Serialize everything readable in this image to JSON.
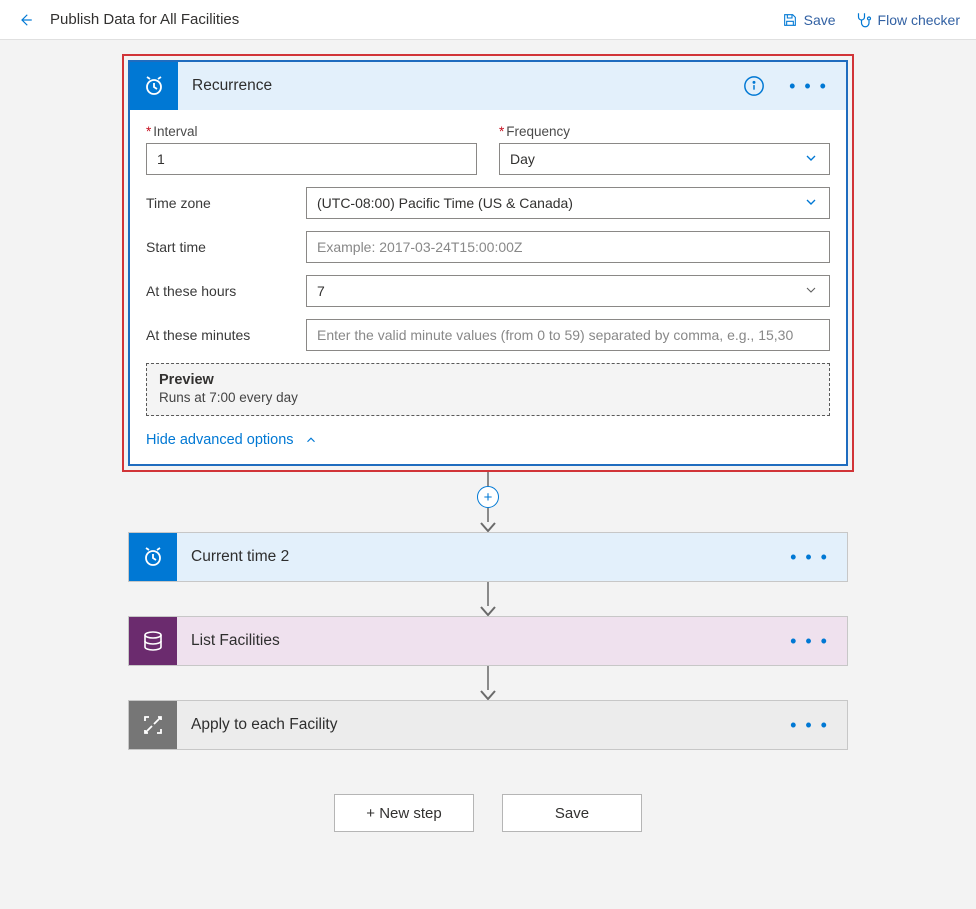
{
  "header": {
    "title": "Publish Data for All Facilities",
    "save_label": "Save",
    "flow_checker_label": "Flow checker"
  },
  "recurrence": {
    "title": "Recurrence",
    "interval_label": "Interval",
    "interval_value": "1",
    "frequency_label": "Frequency",
    "frequency_value": "Day",
    "timezone_label": "Time zone",
    "timezone_value": "(UTC-08:00) Pacific Time (US & Canada)",
    "start_time_label": "Start time",
    "start_time_placeholder": "Example: 2017-03-24T15:00:00Z",
    "hours_label": "At these hours",
    "hours_value": "7",
    "minutes_label": "At these minutes",
    "minutes_placeholder": "Enter the valid minute values (from 0 to 59) separated by comma, e.g., 15,30",
    "preview_title": "Preview",
    "preview_text": "Runs at 7:00 every day",
    "hide_advanced_label": "Hide advanced options",
    "menu": "• • •"
  },
  "steps": {
    "current_time": "Current time 2",
    "list_facilities": "List Facilities",
    "apply_each": "Apply to each Facility",
    "menu": "• • •"
  },
  "buttons": {
    "new_step": "+ New step",
    "save": "Save",
    "plus": "+"
  }
}
